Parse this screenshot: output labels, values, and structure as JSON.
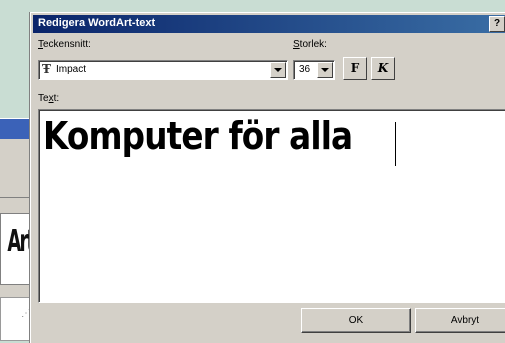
{
  "dialog": {
    "title": "Redigera WordArt-text",
    "help_label": "?",
    "font_label_accel": "T",
    "font_label_rest": "eckensnitt:",
    "font_value": "Impact",
    "size_label_accel": "S",
    "size_label_rest": "torlek:",
    "size_value": "36",
    "bold_label": "F",
    "italic_label": "K",
    "text_label_pre": "Te",
    "text_label_accel": "x",
    "text_label_post": "t:",
    "text_value": "Komputer för alla",
    "ok_label": "OK",
    "cancel_label": "Avbryt"
  },
  "background_window": {
    "preview_text": "Art"
  },
  "colors": {
    "title_bar": "#0a246a",
    "dialog_face": "#d4d0c8",
    "desktop": "#c9ddd3"
  },
  "icons": {
    "font_type": "truetype-icon",
    "dropdown": "chevron-down-icon",
    "help": "help-icon"
  }
}
